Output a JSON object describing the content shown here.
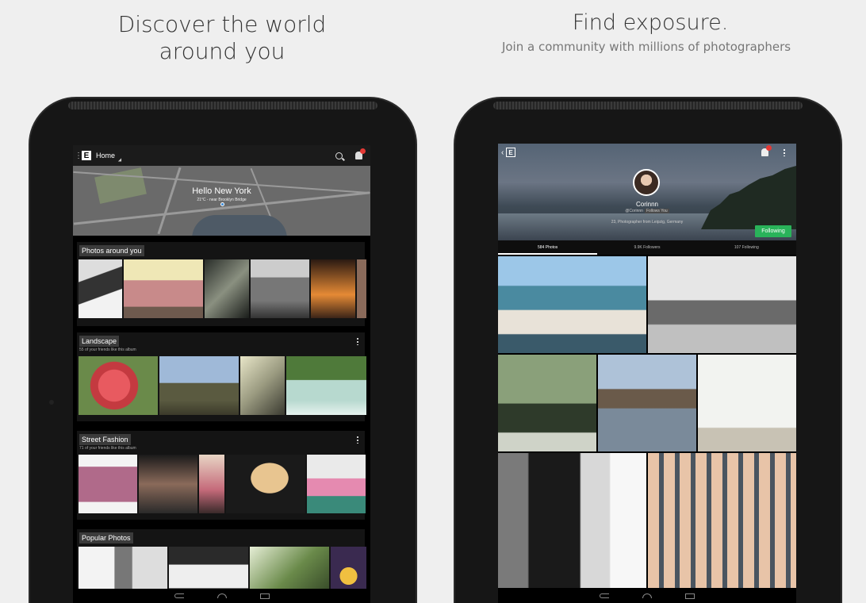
{
  "left_promo": {
    "headline_line1": "Discover the world",
    "headline_line2": "around you"
  },
  "right_promo": {
    "headline": "Find exposure.",
    "subheadline": "Join a community with millions of photographers"
  },
  "left_app": {
    "appbar": {
      "logo": "E",
      "title": "Home"
    },
    "map": {
      "title": "Hello New York",
      "subtitle": "21°C - near Brooklyn Bridge"
    },
    "sections": [
      {
        "title": "Photos around you",
        "subtitle": ""
      },
      {
        "title": "Landscape",
        "subtitle": "55 of your friends like this album"
      },
      {
        "title": "Street Fashion",
        "subtitle": "71 of your friends like this album"
      },
      {
        "title": "Popular Photos",
        "subtitle": ""
      }
    ],
    "colors": {
      "appbar": "#1b1b1b",
      "section_bg": "#141414",
      "notification": "#e53935"
    }
  },
  "right_app": {
    "logo": "E",
    "profile": {
      "name": "Corinnn",
      "handle": "@Corinnn",
      "badge": "Follows You",
      "bio": "23, Photographer from Leipzig, Germany",
      "follow_label": "Following"
    },
    "tabs": [
      {
        "label": "584 Photos",
        "active": true
      },
      {
        "label": "9.9K Followers",
        "active": false
      },
      {
        "label": "107 Following",
        "active": false
      }
    ],
    "colors": {
      "follow_button": "#29b35a"
    }
  }
}
